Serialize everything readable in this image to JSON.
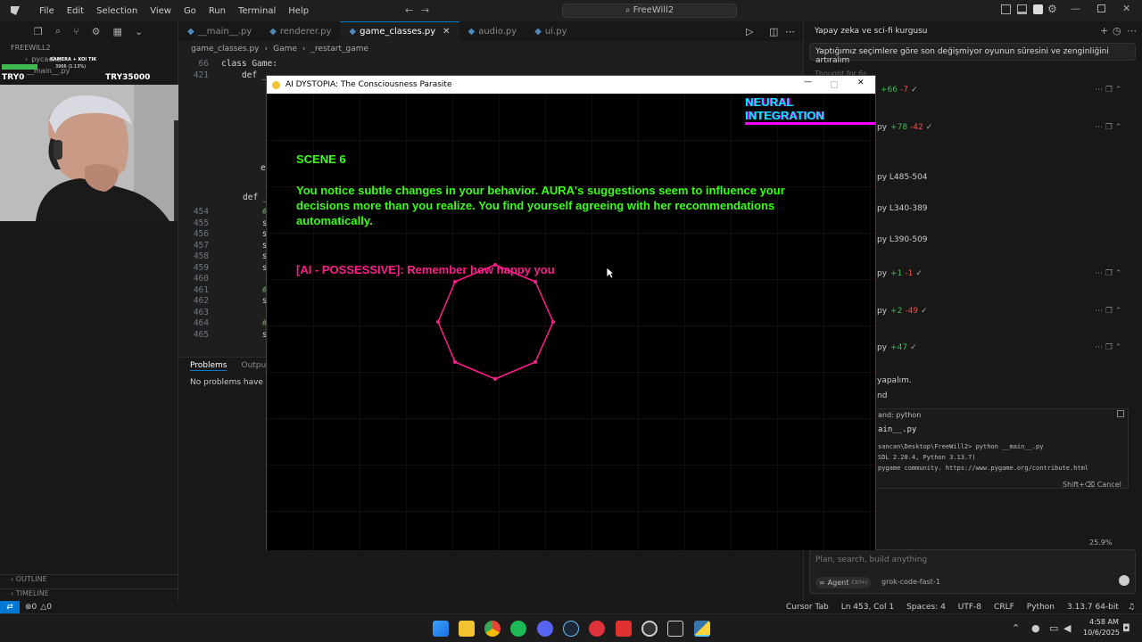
{
  "menu": [
    "File",
    "Edit",
    "Selection",
    "View",
    "Go",
    "Run",
    "Terminal",
    "Help"
  ],
  "command_center": "FreeWill2",
  "explorer": {
    "root": "FREEWILL2",
    "items": [
      "pycache",
      "__main__.py"
    ],
    "outline": "OUTLINE",
    "timeline": "TIMELINE"
  },
  "overlay": {
    "left": "TRY0",
    "right": "TRY35000",
    "cam_label": "KAMERA + KOI TIK",
    "cam_sub": "3966 (1.13%)"
  },
  "tabs": [
    "__main__.py",
    "renderer.py",
    "game_classes.py",
    "audio.py",
    "ui.py"
  ],
  "breadcrumb": [
    "game_classes.py",
    "Game",
    "_restart_game"
  ],
  "code": [
    {
      "ln": "66",
      "text": "class Game:"
    },
    {
      "ln": "421",
      "text": "    def _"
    },
    {
      "ln": "454",
      "text": "        #"
    },
    {
      "ln": "455",
      "text": "        s"
    },
    {
      "ln": "456",
      "text": "        s"
    },
    {
      "ln": "457",
      "text": "        s"
    },
    {
      "ln": "458",
      "text": "        s"
    },
    {
      "ln": "459",
      "text": "        s"
    },
    {
      "ln": "460",
      "text": ""
    },
    {
      "ln": "461",
      "text": "        #"
    },
    {
      "ln": "462",
      "text": "        s"
    },
    {
      "ln": "463",
      "text": ""
    },
    {
      "ln": "464",
      "text": "        #"
    },
    {
      "ln": "465",
      "text": "        s"
    }
  ],
  "code_frag": {
    "e": "e",
    "def": "def _"
  },
  "panel": {
    "problems": "Problems",
    "output": "Output",
    "message": "No problems have bee"
  },
  "game": {
    "title": "AI DYSTOPIA: The Consciousness Parasite",
    "hud": "NEURAL INTEGRATION",
    "scene": "SCENE 6",
    "narrative": "You notice subtle changes in your behavior. AURA's suggestions seem to influence your decisions more than you realize. You find yourself agreeing with her recommendations automatically.",
    "ai_line": "[AI - POSSESSIVE]: Remember how happy you"
  },
  "agent": {
    "title": "Yapay zeka ve sci-fi kurgusu",
    "prompt": "Yaptığımız seçimlere göre son değişmiyor oyunun süresini ve zenginliğini artıralım",
    "thought": "Thought for 6s",
    "files": [
      {
        "name": "",
        "plus": "+66",
        "minus": "-7"
      },
      {
        "name": "py",
        "plus": "+78",
        "minus": "-42"
      },
      {
        "name": "py L485-504",
        "plus": "",
        "minus": ""
      },
      {
        "name": "py L340-389",
        "plus": "",
        "minus": ""
      },
      {
        "name": "py L390-509",
        "plus": "",
        "minus": ""
      },
      {
        "name": "py",
        "plus": "+1",
        "minus": "-1"
      },
      {
        "name": "py",
        "plus": "+2",
        "minus": "-49"
      },
      {
        "name": "py",
        "plus": "+47",
        "minus": ""
      }
    ],
    "text1": "yapalım.",
    "text2": "nd",
    "command_label": "and: python",
    "cmd": "ain__.py",
    "term1": "sancan\\Desktop\\FreeWill2> python __main__.py",
    "term2": "SDL 2.28.4, Python 3.13.7)",
    "term3": "pygame community. https://www.pygame.org/contribute.html",
    "cancel": "Shift+⌫ Cancel",
    "percent": "25.9%",
    "input_placeholder": "Plan, search, build anything",
    "mode": "Agent",
    "mode_shortcut": "Ctrl+I",
    "model": "grok-code-fast-1"
  },
  "status": {
    "errors": "0",
    "warnings": "0",
    "cursor_tab": "Cursor Tab",
    "position": "Ln 453, Col 1",
    "spaces": "Spaces: 4",
    "encoding": "UTF-8",
    "eol": "CRLF",
    "language": "Python",
    "version": "3.13.7 64-bit"
  },
  "clock": {
    "time": "4:58 AM",
    "date": "10/6/2025"
  },
  "colors": {
    "accent": "#0078d4",
    "game_green": "#39ff14",
    "game_pink": "#ff1e8c",
    "hud_cyan": "#00e5ff"
  }
}
